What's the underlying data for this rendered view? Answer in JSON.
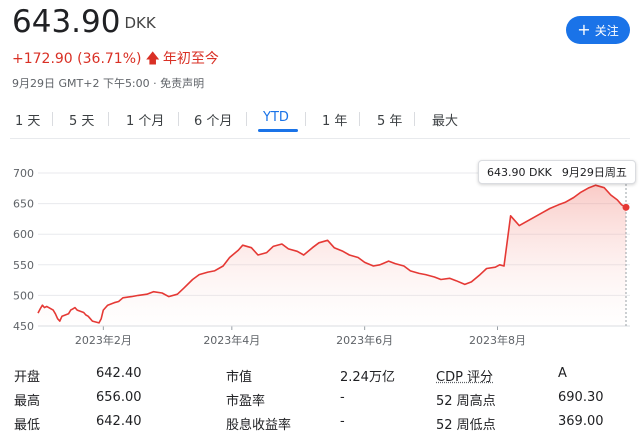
{
  "header": {
    "price": "643.90",
    "currency": "DKK",
    "change": "+172.90 (36.71%)",
    "change_period": "年初至今",
    "timestamp": "9月29日 GMT+2 下午5:00 · 免责声明",
    "follow_label": "关注"
  },
  "colors": {
    "accent": "#1a73e8",
    "negative": "#d93025",
    "chart_line": "#e53935"
  },
  "tabs": [
    {
      "label": "1 天"
    },
    {
      "label": "5 天"
    },
    {
      "label": "1 个月"
    },
    {
      "label": "6 个月"
    },
    {
      "label": "YTD",
      "active": true
    },
    {
      "label": "1 年"
    },
    {
      "label": "5 年"
    },
    {
      "label": "最大"
    }
  ],
  "tooltip": {
    "price": "643.90 DKK",
    "date": "9月29日周五"
  },
  "chart_data": {
    "type": "area",
    "ylim": [
      450,
      700
    ],
    "yticks": [
      "700",
      "650",
      "600",
      "550",
      "500",
      "450"
    ],
    "xticks": [
      "2023年2月",
      "2023年4月",
      "2023年6月",
      "2023年8月"
    ],
    "x": [
      "2023-01-02",
      "2023-01-03",
      "2023-01-04",
      "2023-01-05",
      "2023-01-06",
      "2023-01-09",
      "2023-01-10",
      "2023-01-11",
      "2023-01-12",
      "2023-01-13",
      "2023-01-16",
      "2023-01-17",
      "2023-01-18",
      "2023-01-19",
      "2023-01-20",
      "2023-01-23",
      "2023-01-24",
      "2023-01-25",
      "2023-01-26",
      "2023-01-27",
      "2023-01-30",
      "2023-01-31",
      "2023-02-01",
      "2023-02-02",
      "2023-02-03",
      "2023-02-06",
      "2023-02-08",
      "2023-02-10",
      "2023-02-14",
      "2023-02-17",
      "2023-02-21",
      "2023-02-24",
      "2023-02-28",
      "2023-03-03",
      "2023-03-07",
      "2023-03-10",
      "2023-03-14",
      "2023-03-17",
      "2023-03-21",
      "2023-03-24",
      "2023-03-28",
      "2023-03-31",
      "2023-04-04",
      "2023-04-06",
      "2023-04-10",
      "2023-04-13",
      "2023-04-17",
      "2023-04-20",
      "2023-04-24",
      "2023-04-27",
      "2023-05-01",
      "2023-05-04",
      "2023-05-08",
      "2023-05-11",
      "2023-05-15",
      "2023-05-18",
      "2023-05-22",
      "2023-05-25",
      "2023-05-29",
      "2023-06-01",
      "2023-06-05",
      "2023-06-08",
      "2023-06-12",
      "2023-06-15",
      "2023-06-19",
      "2023-06-22",
      "2023-06-26",
      "2023-06-29",
      "2023-07-03",
      "2023-07-06",
      "2023-07-10",
      "2023-07-13",
      "2023-07-17",
      "2023-07-20",
      "2023-07-24",
      "2023-07-27",
      "2023-07-31",
      "2023-08-02",
      "2023-08-04",
      "2023-08-07",
      "2023-08-09",
      "2023-08-11",
      "2023-08-15",
      "2023-08-18",
      "2023-08-22",
      "2023-08-25",
      "2023-08-29",
      "2023-09-01",
      "2023-09-05",
      "2023-09-08",
      "2023-09-12",
      "2023-09-15",
      "2023-09-19",
      "2023-09-22",
      "2023-09-25",
      "2023-09-27",
      "2023-09-29"
    ],
    "values": [
      471,
      478,
      484,
      480,
      482,
      476,
      470,
      462,
      458,
      466,
      470,
      476,
      478,
      480,
      476,
      472,
      468,
      466,
      462,
      458,
      455,
      462,
      476,
      480,
      484,
      488,
      490,
      496,
      498,
      500,
      502,
      506,
      504,
      498,
      502,
      512,
      526,
      534,
      538,
      540,
      548,
      562,
      574,
      582,
      578,
      566,
      570,
      580,
      584,
      576,
      572,
      566,
      578,
      586,
      590,
      578,
      572,
      566,
      562,
      554,
      548,
      550,
      556,
      552,
      548,
      540,
      536,
      534,
      530,
      526,
      528,
      524,
      518,
      522,
      534,
      544,
      546,
      550,
      548,
      630,
      622,
      614,
      622,
      628,
      636,
      642,
      648,
      652,
      660,
      668,
      676,
      680,
      676,
      664,
      656,
      648,
      643.9
    ],
    "title": "",
    "xlabel": "",
    "ylabel": "",
    "grid": true
  },
  "stats": {
    "col1": [
      {
        "label": "开盘",
        "value": "642.40"
      },
      {
        "label": "最高",
        "value": "656.00"
      },
      {
        "label": "最低",
        "value": "642.40"
      }
    ],
    "col2": [
      {
        "label": "市值",
        "value": "2.24万亿"
      },
      {
        "label": "市盈率",
        "value": "-"
      },
      {
        "label": "股息收益率",
        "value": "-"
      }
    ],
    "col3": [
      {
        "label": "CDP 评分",
        "value": "A"
      },
      {
        "label": "52 周高点",
        "value": "690.30"
      },
      {
        "label": "52 周低点",
        "value": "369.00"
      }
    ]
  }
}
